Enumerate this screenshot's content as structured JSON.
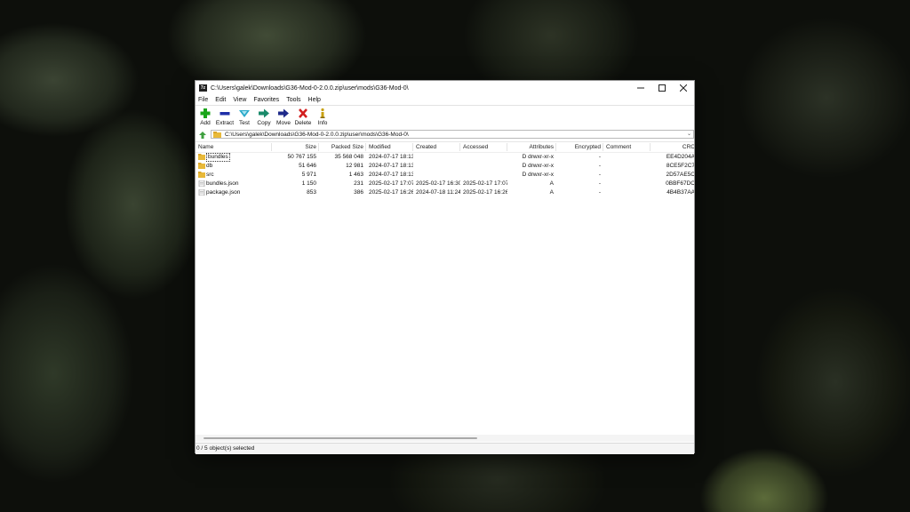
{
  "window": {
    "title": "C:\\Users\\galek\\Downloads\\G36-Mod-0-2.0.0.zip\\user\\mods\\G36-Mod-0\\",
    "app_icon_text": "7z"
  },
  "menu": [
    "File",
    "Edit",
    "View",
    "Favorites",
    "Tools",
    "Help"
  ],
  "toolbar": [
    {
      "label": "Add",
      "icon": "plus-icon",
      "color": "#1aa51a"
    },
    {
      "label": "Extract",
      "icon": "minus-icon",
      "color": "#1f2fa8"
    },
    {
      "label": "Test",
      "icon": "check-icon",
      "color": "#29a9c9"
    },
    {
      "label": "Copy",
      "icon": "copy-arrow-icon",
      "color": "#1a8a6a"
    },
    {
      "label": "Move",
      "icon": "move-arrow-icon",
      "color": "#1f2a8a"
    },
    {
      "label": "Delete",
      "icon": "delete-x-icon",
      "color": "#d21f1f"
    },
    {
      "label": "Info",
      "icon": "info-icon",
      "color": "#c8a010"
    }
  ],
  "address": {
    "path": "C:\\Users\\galek\\Downloads\\G36-Mod-0-2.0.0.zip\\user\\mods\\G36-Mod-0\\"
  },
  "columns": {
    "name": "Name",
    "size": "Size",
    "packed": "Packed Size",
    "modified": "Modified",
    "created": "Created",
    "accessed": "Accessed",
    "attributes": "Attributes",
    "encrypted": "Encrypted",
    "comment": "Comment",
    "crc": "CRC"
  },
  "rows": [
    {
      "type": "folder",
      "name": "bundles",
      "size": "50 767 155",
      "packed": "35 568 048",
      "modified": "2024-07-17 18:13",
      "created": "",
      "accessed": "",
      "attributes": "D drwxr-xr-x",
      "encrypted": "-",
      "comment": "",
      "crc": "EE4D204A"
    },
    {
      "type": "folder",
      "name": "db",
      "size": "51 646",
      "packed": "12 981",
      "modified": "2024-07-17 18:13",
      "created": "",
      "accessed": "",
      "attributes": "D drwxr-xr-x",
      "encrypted": "-",
      "comment": "",
      "crc": "8CE5F2C7"
    },
    {
      "type": "folder",
      "name": "src",
      "size": "5 971",
      "packed": "1 463",
      "modified": "2024-07-17 18:13",
      "created": "",
      "accessed": "",
      "attributes": "D drwxr-xr-x",
      "encrypted": "-",
      "comment": "",
      "crc": "2D57AE5C"
    },
    {
      "type": "file",
      "name": "bundles.json",
      "size": "1 150",
      "packed": "231",
      "modified": "2025-02-17 17:07",
      "created": "2025-02-17 16:30",
      "accessed": "2025-02-17 17:07",
      "attributes": "A",
      "encrypted": "-",
      "comment": "",
      "crc": "0BBF67DC"
    },
    {
      "type": "file",
      "name": "package.json",
      "size": "853",
      "packed": "386",
      "modified": "2025-02-17 16:26",
      "created": "2024-07-18 11:24",
      "accessed": "2025-02-17 16:26",
      "attributes": "A",
      "encrypted": "-",
      "comment": "",
      "crc": "4B4B37AA"
    }
  ],
  "status": {
    "selection": "0 / 5 object(s) selected"
  }
}
